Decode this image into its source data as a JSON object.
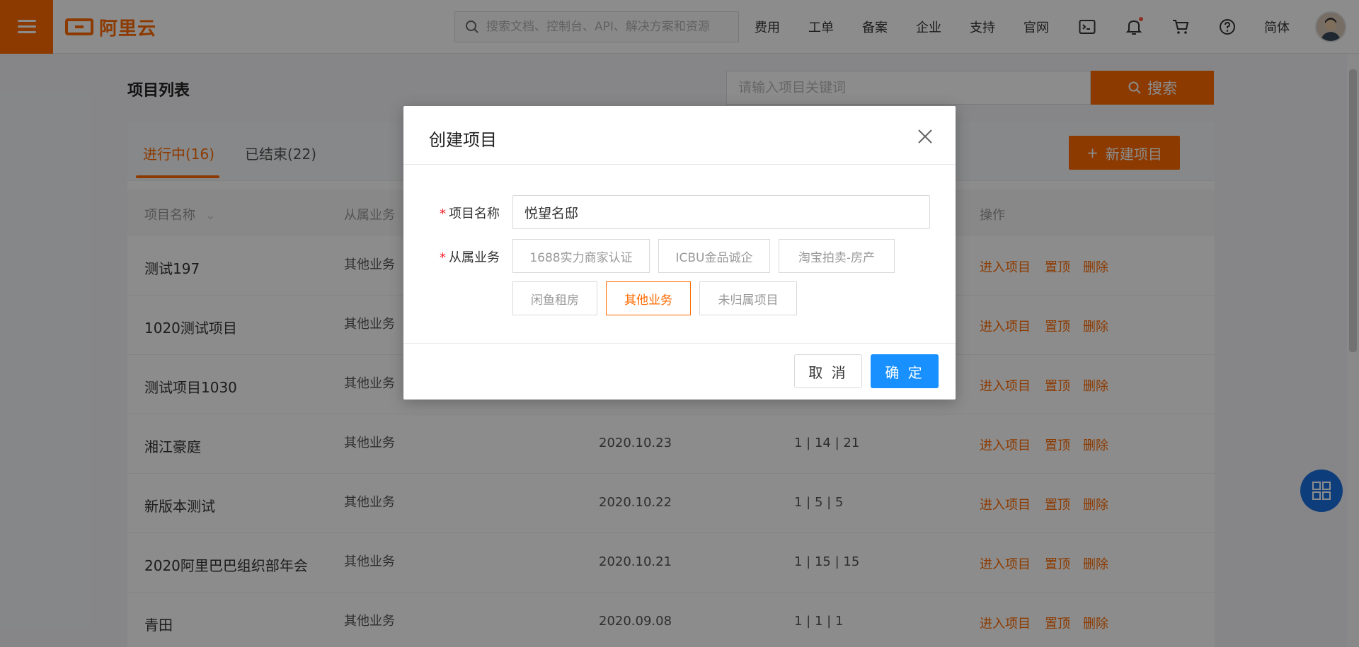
{
  "header": {
    "logo_text": "阿里云",
    "search_placeholder": "搜索文档、控制台、API、解决方案和资源",
    "nav": [
      "费用",
      "工单",
      "备案",
      "企业",
      "支持",
      "官网"
    ],
    "icons": [
      "terminal-icon",
      "bell-icon",
      "cart-icon",
      "help-icon"
    ],
    "lang": "简体"
  },
  "page": {
    "title": "项目列表",
    "search_placeholder": "请输入项目关键词",
    "search_button": "搜索",
    "tabs": [
      {
        "label": "进行中(16)",
        "active": true
      },
      {
        "label": "已结束(22)",
        "active": false
      }
    ],
    "new_project_button": "新建项目",
    "columns": {
      "name": "项目名称",
      "biz": "从属业务",
      "ops": "操作"
    },
    "rows": [
      {
        "name": "测试197",
        "biz": "其他业务",
        "date": "",
        "stat": ""
      },
      {
        "name": "1020测试项目",
        "biz": "其他业务",
        "date": "",
        "stat": ""
      },
      {
        "name": "测试项目1030",
        "biz": "其他业务",
        "date": "",
        "stat": ""
      },
      {
        "name": "湘江豪庭",
        "biz": "其他业务",
        "date": "2020.10.23",
        "stat": "1 | 14 | 21"
      },
      {
        "name": "新版本测试",
        "biz": "其他业务",
        "date": "2020.10.22",
        "stat": "1 | 5 | 5"
      },
      {
        "name": "2020阿里巴巴组织部年会",
        "biz": "其他业务",
        "date": "2020.10.21",
        "stat": "1 | 15 | 15"
      },
      {
        "name": "青田",
        "biz": "其他业务",
        "date": "2020.09.08",
        "stat": "1 | 1 | 1"
      }
    ],
    "row_actions": [
      "进入项目",
      "置顶",
      "删除"
    ]
  },
  "modal": {
    "title": "创建项目",
    "name_label": "项目名称",
    "name_value": "悦望名邸",
    "biz_label": "从属业务",
    "biz_options": [
      {
        "label": "1688实力商家认证",
        "selected": false
      },
      {
        "label": "ICBU金品诚企",
        "selected": false
      },
      {
        "label": "淘宝拍卖-房产",
        "selected": false
      },
      {
        "label": "闲鱼租房",
        "selected": false
      },
      {
        "label": "其他业务",
        "selected": true
      },
      {
        "label": "未归属项目",
        "selected": false
      }
    ],
    "cancel": "取 消",
    "ok": "确 定"
  },
  "colors": {
    "brand": "#ff6a00",
    "primary": "#1890ff",
    "required": "#f5222d"
  }
}
